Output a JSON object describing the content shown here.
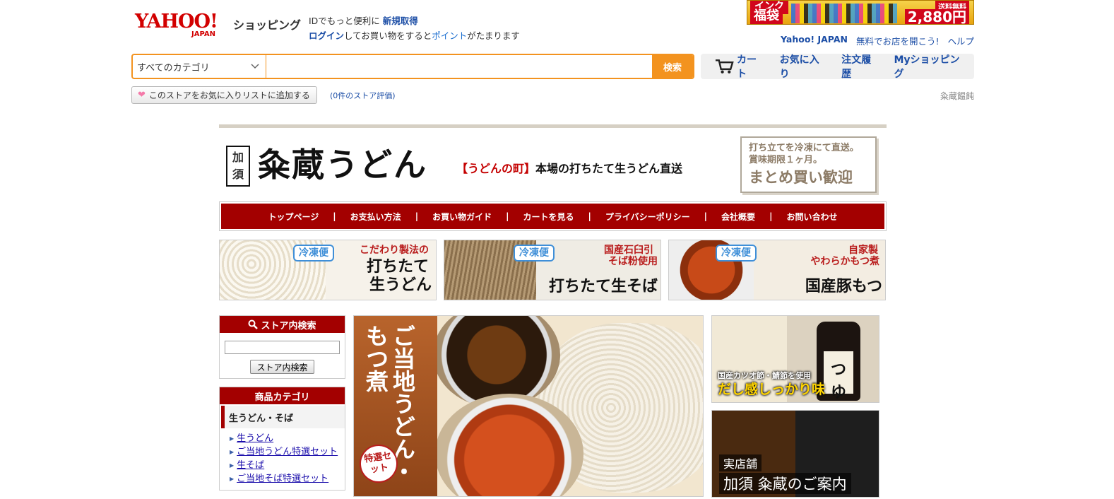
{
  "header": {
    "logo_text": "YAHOO!",
    "logo_sub": "JAPAN",
    "shopping_label": "ショッピング",
    "login_line1_pre": "IDでもっと便利に",
    "login_line1_link": "新規取得",
    "login_line2_link": "ログイン",
    "login_line2_mid": "してお買い物をすると",
    "login_line2_point": "ポイント",
    "login_line2_post": "がたまります",
    "util_links": [
      "Yahoo! JAPAN",
      "無料でお店を開こう!",
      "ヘルプ"
    ]
  },
  "promo_banner": {
    "label1": "インク",
    "label2": "福袋",
    "free_shipping": "送料無料",
    "price": "2,880円"
  },
  "search": {
    "category_value": "すべてのカテゴリ",
    "query": "",
    "button_label": "検索"
  },
  "nav": {
    "cart": "カート",
    "favorites": "お気に入り",
    "orders": "注文履歴",
    "my_shopping": "Myショッピング"
  },
  "store_bar": {
    "fav_button": "このストアをお気に入りリストに追加する",
    "rating": "(0件のストア評価)",
    "store_name": "粂蔵饂飩"
  },
  "store": {
    "kazo_char1": "加",
    "kazo_char2": "須",
    "title": "粂蔵うどん",
    "tagline_red": "【うどんの町】",
    "tagline": "本場の打ちたて生うどん直送",
    "reco_line1": "打ち立てを冷凍にて直送。",
    "reco_line2": "賞味期限１ヶ月。",
    "reco_line3": "まとめ買い歓迎",
    "menu": [
      "トップページ",
      "お支払い方法",
      "お買い物ガイド",
      "カートを見る",
      "プライバシーポリシー",
      "会社概要",
      "お問い合わせ"
    ],
    "menu_separator": "|"
  },
  "promos": [
    {
      "frozen": "冷凍便",
      "sub": "こだわり製法の",
      "main1": "打ちたて",
      "main2": "生うどん"
    },
    {
      "frozen": "冷凍便",
      "sub": "国産石臼引",
      "sub2": "そば粉使用",
      "main1": "打ちたて生そば",
      "main2": ""
    },
    {
      "frozen": "冷凍便",
      "sub": "自家製",
      "sub2": "やわらかもつ煮",
      "main1": "国産豚もつ",
      "main2": ""
    }
  ],
  "sidebar": {
    "search_title": "ストア内検索",
    "search_value": "",
    "search_button": "ストア内検索",
    "category_title": "商品カテゴリ",
    "group": "生うどん・そば",
    "items": [
      "生うどん",
      "ご当地うどん特選セット",
      "生そば",
      "ご当地そば特選セット"
    ]
  },
  "hero": {
    "vertical_text": "ご当地うどん・もつ煮",
    "badge": "特選セット"
  },
  "right_banners": {
    "tsuyu_label": "つゆ",
    "tsuyu_caption1": "国産カツオ節・鯖節を使用",
    "tsuyu_caption2": "だし感しっかり味",
    "shop_tag": "実店舗",
    "shop_name": "加須 粂蔵のご案内"
  },
  "colors": {
    "accent_orange": "#f3931f",
    "brand_red": "#a30000",
    "link_blue": "#1c4ea6"
  }
}
